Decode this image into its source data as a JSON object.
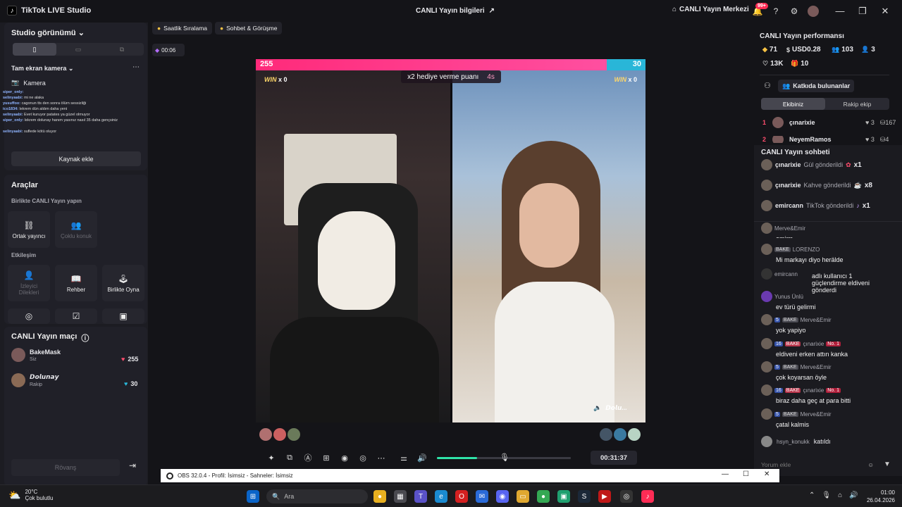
{
  "app": {
    "title": "TikTok LIVE Studio",
    "center_title": "CANLI Yayın bilgileri",
    "center_right": "CANLI Yayın Merkezi",
    "notif_badge": "99+"
  },
  "left": {
    "studio_view": "Studio görünümü",
    "camera_mode": "Tam ekran kamera",
    "camera_label": "Kamera",
    "chat_preview": [
      {
        "user": "siper_only:",
        "text": ""
      },
      {
        "user": "selinyaabi:",
        "text": "mi ne alaka"
      },
      {
        "user": "yusuffoo:",
        "text": "cagonun tts den sonra ölürn sessizliği"
      },
      {
        "user": "ico1834:",
        "text": "lekrem dün aldım daha yeni"
      },
      {
        "user": "selinyaabi:",
        "text": "Evet kuruyor patates ya güzel olmuyor"
      },
      {
        "user": "siper_only:",
        "text": "lekrem dolunay hanım yasınız nasıl 35 daha gençsiniz"
      },
      {
        "user": "selinyaabi:",
        "text": "suflede kötü oluyor"
      }
    ],
    "add_source": "Kaynak ekle",
    "tools_title": "Araçlar",
    "together_title": "Birlikte CANLI Yayın yapın",
    "cohost": "Ortak yayıncı",
    "multi_guest": "Çoklu konuk",
    "interaction_title": "Etkileşim",
    "viewer_wishes": "İzleyici Dilekleri",
    "guide": "Rehber",
    "play_together": "Birlikte Oyna",
    "match_title": "CANLI Yayın maçı",
    "player1": {
      "name": "BakeMask",
      "sub": "Siz",
      "score": "255"
    },
    "player2": {
      "name": "𝘿𝙤𝙡𝙪𝙣𝙖𝙮",
      "sub": "Rakip",
      "score": "30"
    },
    "rematch": "Rövanş"
  },
  "center": {
    "chip1": "Saatlik Sıralama",
    "chip2": "Sohbet & Görüşme",
    "timer": "00:06",
    "score_left": "255",
    "score_right": "30",
    "progress_left_fraction": 0.9,
    "win_left": "WIN",
    "win_left_x": "x 0",
    "win_right": "WIN",
    "win_right_x": "x 0",
    "bonus_text": "x2 hediye verme puanı",
    "bonus_time": "4s",
    "opponent_tag": "𝘿𝙤𝙡𝙪...",
    "duration": "00:31:37",
    "volume_fraction": 0.3
  },
  "right": {
    "perf_title": "CANLI Yayın performansı",
    "diamonds": "71",
    "usd": "USD0.28",
    "viewers": "103",
    "shares": "3",
    "likes": "13K",
    "gifts": "10",
    "contributors": "Katkıda bulunanlar",
    "tab_team": "Ekibiniz",
    "tab_rival": "Rakip ekip",
    "rank1": {
      "num": "1",
      "name": "çınarixie",
      "hearts": "3",
      "score": "167"
    },
    "rank2": {
      "num": "2",
      "name": "NeyemRamos",
      "hearts": "3",
      "score": "4"
    },
    "chat_title": "CANLI Yayın sohbeti",
    "gifts_list": [
      {
        "user": "çınarixie",
        "text": "Gül gönderildi",
        "count": "x1"
      },
      {
        "user": "çınarixie",
        "text": "Kahve gönderildi",
        "count": "x8"
      },
      {
        "user": "emircann",
        "text": "TikTok gönderildi",
        "count": "x1"
      }
    ],
    "messages": [
      {
        "meta": "Merve&Emir",
        "body": "emirrr"
      },
      {
        "meta": "LORENZO",
        "tag": "BAKE",
        "body": "Mi markayı diyo herälde"
      },
      {
        "meta": "emircann",
        "body": "adlı kullanıcı 1 güçlendirme eldiveni gönderdi"
      },
      {
        "meta": "Yunus Ünlü",
        "body": "ev türü gelirmi"
      },
      {
        "lv": "5",
        "tag": "BAKE",
        "meta": "Merve&Emir",
        "body": "yok yapiyo"
      },
      {
        "lv": "16",
        "tag": "BAKE",
        "meta": "çınarixie",
        "no1": "No. 1",
        "body": "eldiveni erken attın kanka"
      },
      {
        "lv": "5",
        "tag": "BAKE",
        "meta": "Merve&Emir",
        "body": "çok koyarsan öyle"
      },
      {
        "lv": "16",
        "tag": "BAKE",
        "meta": "çınarixie",
        "no1": "No. 1",
        "body": "biraz daha geç at para bitti"
      },
      {
        "lv": "5",
        "tag": "BAKE",
        "meta": "Merve&Emir",
        "body": "çatal kalmis"
      },
      {
        "meta": "hsyn_konukk",
        "body": "katıldı"
      }
    ],
    "comment_placeholder": "Yorum ekle"
  },
  "obs": {
    "title": "OBS 32.0.4 - Profil: İsimsiz - Sahneler: İsimsiz"
  },
  "taskbar": {
    "temp": "20°C",
    "weather": "Çok bulutlu",
    "search": "Ara",
    "time": "01:00",
    "date": "26.04.2026"
  },
  "colors": {
    "accent_pink": "#fe2c55",
    "accent_cyan": "#29b6d8",
    "volume_green": "#2fe4a8"
  }
}
